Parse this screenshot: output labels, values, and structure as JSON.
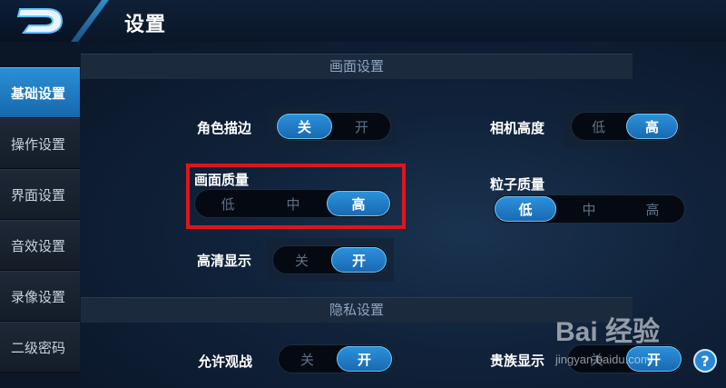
{
  "header": {
    "title": "设置"
  },
  "sidebar": {
    "items": [
      {
        "label": "基础设置",
        "active": true
      },
      {
        "label": "操作设置"
      },
      {
        "label": "界面设置"
      },
      {
        "label": "音效设置"
      },
      {
        "label": "录像设置"
      },
      {
        "label": "二级密码"
      }
    ]
  },
  "sections": {
    "display": "画面设置",
    "privacy": "隐私设置"
  },
  "settings": {
    "outline": {
      "label": "角色描边",
      "options": [
        "关",
        "开"
      ],
      "selected": "关"
    },
    "camera": {
      "label": "相机高度",
      "options": [
        "低",
        "高"
      ],
      "selected": "高"
    },
    "quality": {
      "label": "画面质量",
      "options": [
        "低",
        "中",
        "高"
      ],
      "selected": "高"
    },
    "particle": {
      "label": "粒子质量",
      "options": [
        "低",
        "中",
        "高"
      ],
      "selected": "低"
    },
    "hd": {
      "label": "高清显示",
      "options": [
        "关",
        "开"
      ],
      "selected": "开"
    },
    "spectate": {
      "label": "允许观战",
      "options": [
        "关",
        "开"
      ],
      "selected": "开"
    },
    "noble": {
      "label": "贵族显示",
      "options": [
        "关",
        "开"
      ],
      "selected": "开"
    }
  },
  "watermark": {
    "logo": "Bai 经验",
    "url": "jingyan.baidu.com"
  },
  "help": {
    "label": "?"
  },
  "colors": {
    "accent": "#1f7ac4",
    "highlight": "#e0141c",
    "background": "#0b1626"
  }
}
